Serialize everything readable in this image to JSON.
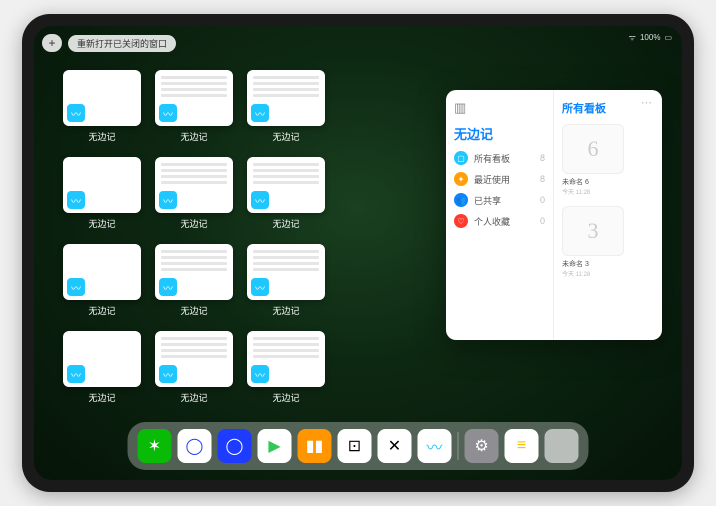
{
  "top": {
    "plus": "+",
    "reopen_label": "重新打开已关闭的窗口",
    "battery": "100%"
  },
  "app_switcher": {
    "app_name": "无边记",
    "thumbs": [
      {
        "variant": "blank"
      },
      {
        "variant": "rows"
      },
      {
        "variant": "rows"
      },
      null,
      {
        "variant": "blank"
      },
      {
        "variant": "rows"
      },
      {
        "variant": "rows"
      },
      null,
      {
        "variant": "blank"
      },
      {
        "variant": "rows"
      },
      {
        "variant": "rows"
      },
      null,
      {
        "variant": "blank"
      },
      {
        "variant": "rows"
      },
      {
        "variant": "rows"
      }
    ]
  },
  "popover": {
    "left_title": "无边记",
    "items": [
      {
        "label": "所有看板",
        "count": "8",
        "color": "#1fc7ff",
        "glyph": "▢"
      },
      {
        "label": "最近使用",
        "count": "8",
        "color": "#ff9f0a",
        "glyph": "✦"
      },
      {
        "label": "已共享",
        "count": "0",
        "color": "#0a84ff",
        "glyph": "👥"
      },
      {
        "label": "个人收藏",
        "count": "0",
        "color": "#ff3b30",
        "glyph": "♡"
      }
    ],
    "right_title": "所有看板",
    "boards": [
      {
        "glyph": "6",
        "label": "未命名 6",
        "time": "今天 11:28"
      },
      {
        "glyph": "3",
        "label": "未命名 3",
        "time": "今天 11:28"
      }
    ]
  },
  "dock": [
    {
      "name": "wechat",
      "bg": "#09bb07",
      "glyph": "✶"
    },
    {
      "name": "quark-hd",
      "bg": "#fff",
      "glyph": "◯",
      "fg": "#1e3cff"
    },
    {
      "name": "quark",
      "bg": "#1e3cff",
      "glyph": "◯"
    },
    {
      "name": "play",
      "bg": "#fff",
      "glyph": "▶",
      "fg": "#34c759"
    },
    {
      "name": "books",
      "bg": "#ff9500",
      "glyph": "▮▮"
    },
    {
      "name": "dice",
      "bg": "#fff",
      "glyph": "⊡",
      "fg": "#000"
    },
    {
      "name": "connect",
      "bg": "#fff",
      "glyph": "✕",
      "fg": "#000"
    },
    {
      "name": "freeform",
      "bg": "#fff",
      "glyph": "〰",
      "fg": "#1fc7ff"
    },
    {
      "name": "settings",
      "bg": "#8e8e93",
      "glyph": "⚙"
    },
    {
      "name": "notes",
      "bg": "#fff",
      "glyph": "≡",
      "fg": "#fcc400"
    }
  ]
}
